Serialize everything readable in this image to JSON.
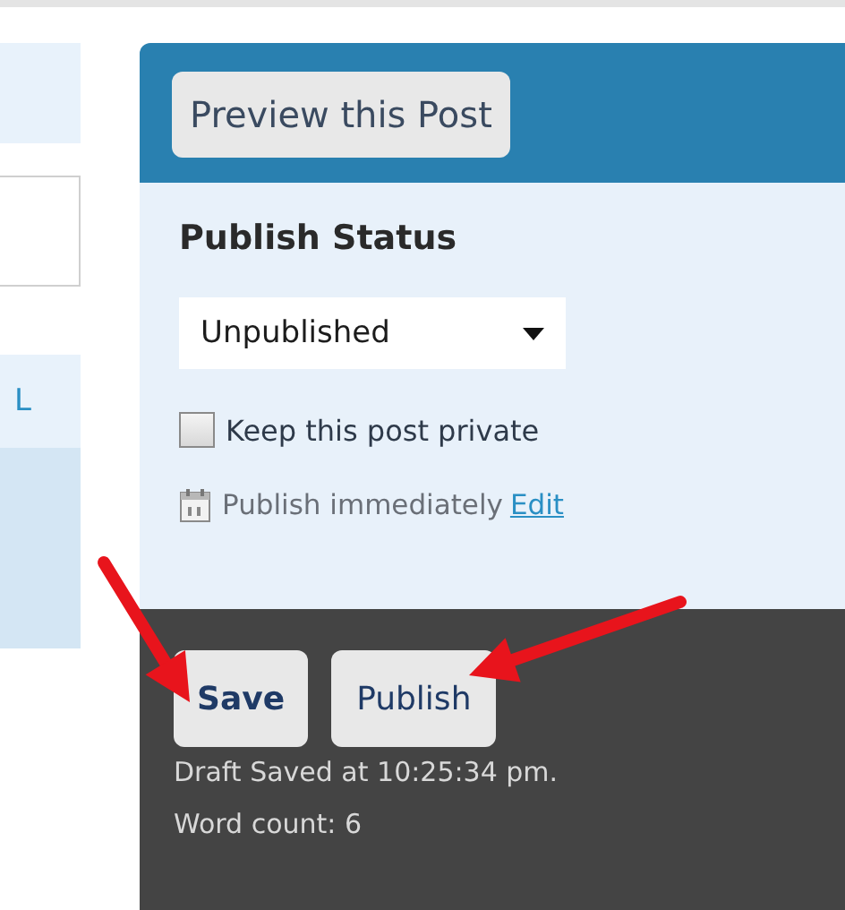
{
  "sidebar": {
    "link": "L"
  },
  "preview_button": "Preview this Post",
  "publish_status": {
    "title": "Publish Status",
    "select": {
      "value": "Unpublished"
    },
    "private": {
      "label": "Keep this post private",
      "checked": false
    },
    "schedule": {
      "text": "Publish immediately",
      "link": "Edit"
    }
  },
  "actions": [
    {
      "label": "Save",
      "kind": "save"
    },
    {
      "label": "Publish",
      "kind": "publish"
    }
  ],
  "status": [
    "Draft Saved at 10:25:34 pm.",
    "Word count: 6"
  ]
}
